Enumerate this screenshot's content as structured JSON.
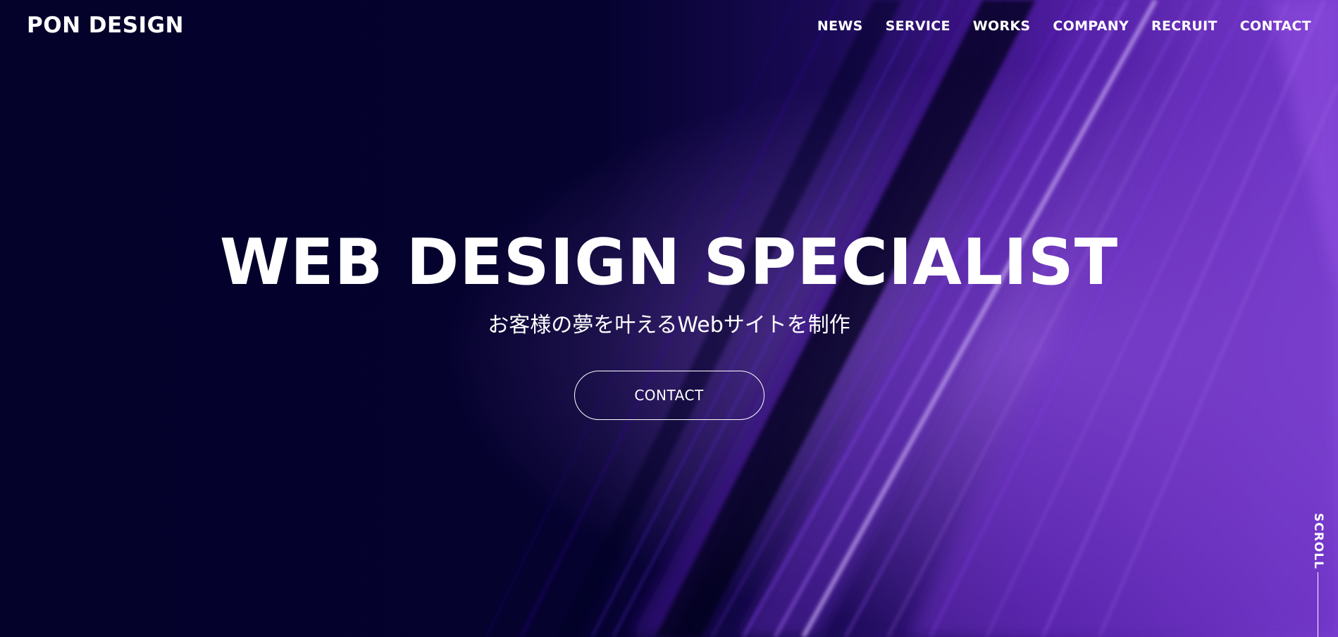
{
  "header": {
    "logo": "PON DESIGN"
  },
  "nav": {
    "items": [
      {
        "label": "NEWS"
      },
      {
        "label": "SERVICE"
      },
      {
        "label": "WORKS"
      },
      {
        "label": "COMPANY"
      },
      {
        "label": "RECRUIT"
      },
      {
        "label": "CONTACT"
      }
    ]
  },
  "hero": {
    "title": "WEB DESIGN SPECIALIST",
    "subtitle": "お客様の夢を叶えるWebサイトを制作",
    "cta_label": "CONTACT"
  },
  "scroll": {
    "label": "SCROLL"
  },
  "colors": {
    "background": "#05022a",
    "accent_purple": "#8a3fe6",
    "text": "#ffffff"
  }
}
